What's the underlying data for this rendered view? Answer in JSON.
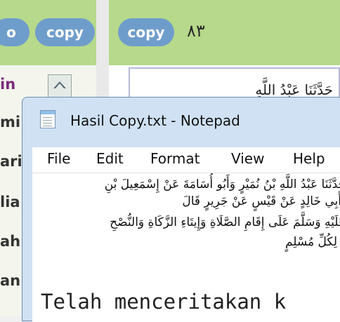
{
  "background": {
    "left_pills": [
      {
        "label": "o"
      },
      {
        "label": "copy"
      }
    ],
    "right_pill": "copy",
    "page_number": "٨٣",
    "name_fragments": [
      "in",
      "mi",
      "ari",
      "lia",
      "ah",
      "an"
    ],
    "snippet_arabic": "حَدَّثَنَا عَبْدُ اللَّهِ"
  },
  "notepad": {
    "title": "Hasil Copy.txt - Notepad",
    "menu": [
      "File",
      "Edit",
      "Format",
      "View",
      "Help"
    ],
    "lines_arabic": [
      "حَدَّثَنَا عَبْدُ اللَّهِ بْنُ نُمَيْرٍ وَأَبُو أُسَامَةَ عَنْ إِسْمَعِيلَ بْنِ",
      "أَبِي خَالِدٍ عَنْ قَيْسٍ عَنْ جَرِيرٍ قَالَ",
      "عَلَيْهِ وَسَلَّمَ عَلَى إِقَامِ الصَّلَاةِ وَإِيتَاءِ الزَّكَاةِ وَالنُّصْحِ",
      "لِكُلِّ مُسْلِمٍ"
    ],
    "latin_line": "Telah menceritakan k"
  }
}
